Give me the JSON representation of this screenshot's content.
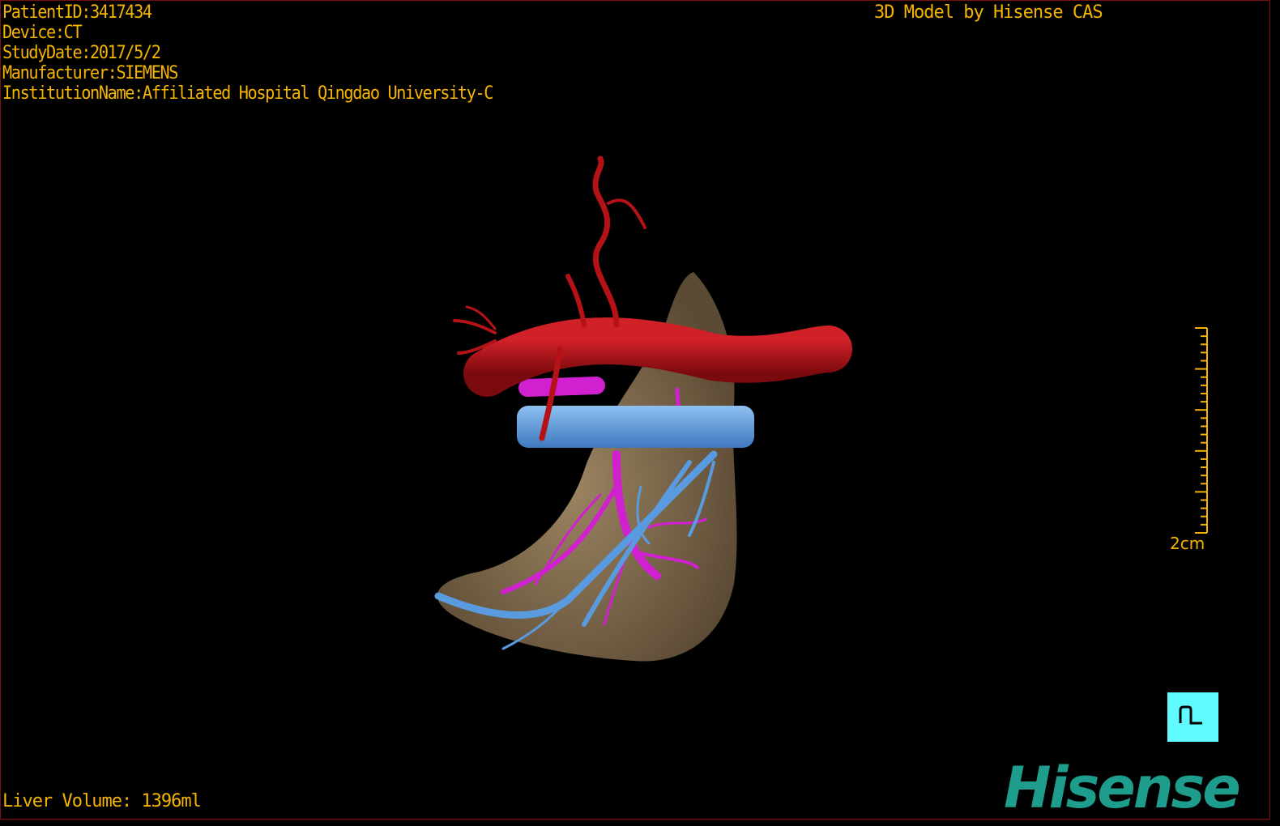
{
  "overlay": {
    "patient_id": "PatientID:3417434",
    "device": "Device:CT",
    "study_date": "StudyDate:2017/5/2",
    "manufacturer": "Manufacturer:SIEMENS",
    "institution": "InstitutionName:Affiliated Hospital Qingdao University-C",
    "model_credit": "3D Model by Hisense CAS",
    "liver_volume": "Liver Volume: 1396ml"
  },
  "scale_bar": {
    "label": "2cm"
  },
  "orientation_marker": {
    "icon": "patient-orientation-icon"
  },
  "logo": {
    "text": "Hisense"
  },
  "colors": {
    "text": "#f5b400",
    "artery": "#b51218",
    "portal_vein": "#d020d0",
    "hepatic_vein": "#5a9be0",
    "liver": "#8a7455",
    "marker": "#5ffbff",
    "logo": "#1e9c8c"
  }
}
